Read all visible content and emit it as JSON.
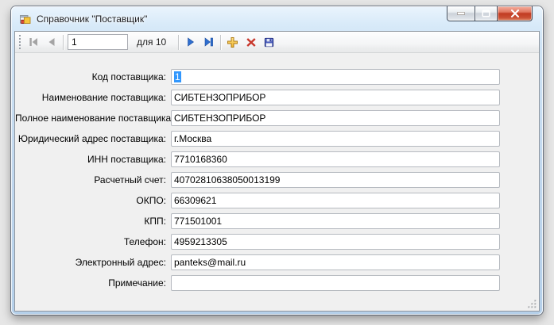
{
  "window": {
    "title": "Справочник \"Поставщик\"",
    "caption_buttons": [
      "minimize",
      "maximize",
      "close"
    ]
  },
  "toolbar": {
    "position_value": "1",
    "count_label": "для 10",
    "buttons": [
      {
        "name": "move-first",
        "enabled": false
      },
      {
        "name": "move-previous",
        "enabled": false
      },
      {
        "name": "move-next",
        "enabled": true
      },
      {
        "name": "move-last",
        "enabled": true
      },
      {
        "name": "add-new",
        "enabled": true
      },
      {
        "name": "delete",
        "enabled": true
      },
      {
        "name": "save",
        "enabled": true
      }
    ]
  },
  "fields": [
    {
      "label": "Код поставщика:",
      "value": "1",
      "selected": true
    },
    {
      "label": "Наименование поставщика:",
      "value": "СИБТЕНЗОПРИБОР",
      "selected": false
    },
    {
      "label": "Полное наименование поставщика:",
      "value": "СИБТЕНЗОПРИБОР",
      "selected": false
    },
    {
      "label": "Юридический адрес поставщика:",
      "value": "г.Москва",
      "selected": false
    },
    {
      "label": "ИНН поставщика:",
      "value": "7710168360",
      "selected": false
    },
    {
      "label": "Расчетный счет:",
      "value": "40702810638050013199",
      "selected": false
    },
    {
      "label": "ОКПО:",
      "value": "66309621",
      "selected": false
    },
    {
      "label": "КПП:",
      "value": "771501001",
      "selected": false
    },
    {
      "label": "Телефон:",
      "value": "4959213305",
      "selected": false
    },
    {
      "label": "Электронный адрес:",
      "value": "panteks@mail.ru",
      "selected": false
    },
    {
      "label": "Примечание:",
      "value": "",
      "selected": false
    }
  ],
  "colors": {
    "selection": "#3297fd",
    "titlebar_glass": "#cfe3f5",
    "close_button_red": "#c13b22",
    "nav_arrow_enabled": "#2f6fd0",
    "nav_arrow_disabled": "#a4a4a4",
    "add_icon_gold": "#f6c63d",
    "delete_icon_red": "#c8372b",
    "save_icon_blue": "#3a53c4",
    "client_background": "#f0f0f0"
  }
}
